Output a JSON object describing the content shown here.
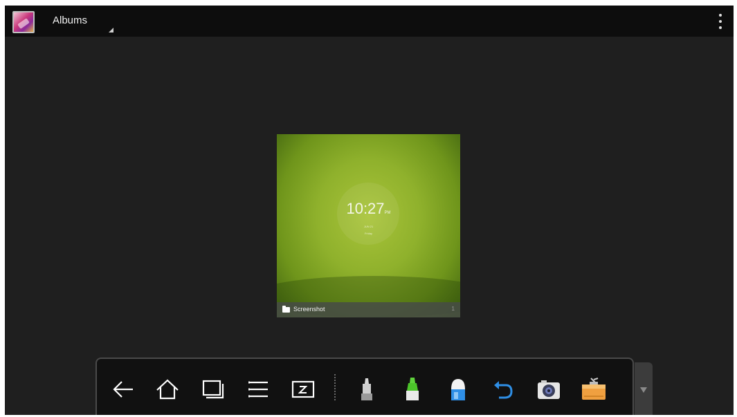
{
  "action_bar": {
    "title": "Albums",
    "app_icon": "gallery-icon",
    "overflow_icon": "more-vert-icon"
  },
  "album": {
    "name": "Screenshot",
    "count": "1",
    "thumbnail": {
      "time": "10:27",
      "ampm": "PM",
      "date": "JUN 21",
      "day": "Friday"
    }
  },
  "toolbar": {
    "items": [
      {
        "icon": "back-arrow-icon"
      },
      {
        "icon": "home-icon"
      },
      {
        "icon": "recent-apps-icon"
      },
      {
        "icon": "menu-icon"
      },
      {
        "icon": "whiteboard-icon"
      },
      {
        "icon": "marker-pen-icon"
      },
      {
        "icon": "highlighter-icon"
      },
      {
        "icon": "eraser-icon"
      },
      {
        "icon": "undo-icon"
      },
      {
        "icon": "camera-icon"
      },
      {
        "icon": "toolbox-icon"
      }
    ],
    "collapse_icon": "chevron-down-icon"
  },
  "colors": {
    "background": "#1f1f1f",
    "action_bar": "#0d0d0d",
    "tile_green": "#8fb12c",
    "undo_blue": "#2f8fe6",
    "highlighter_green": "#5fd23c",
    "toolbox_orange": "#f0a040"
  }
}
